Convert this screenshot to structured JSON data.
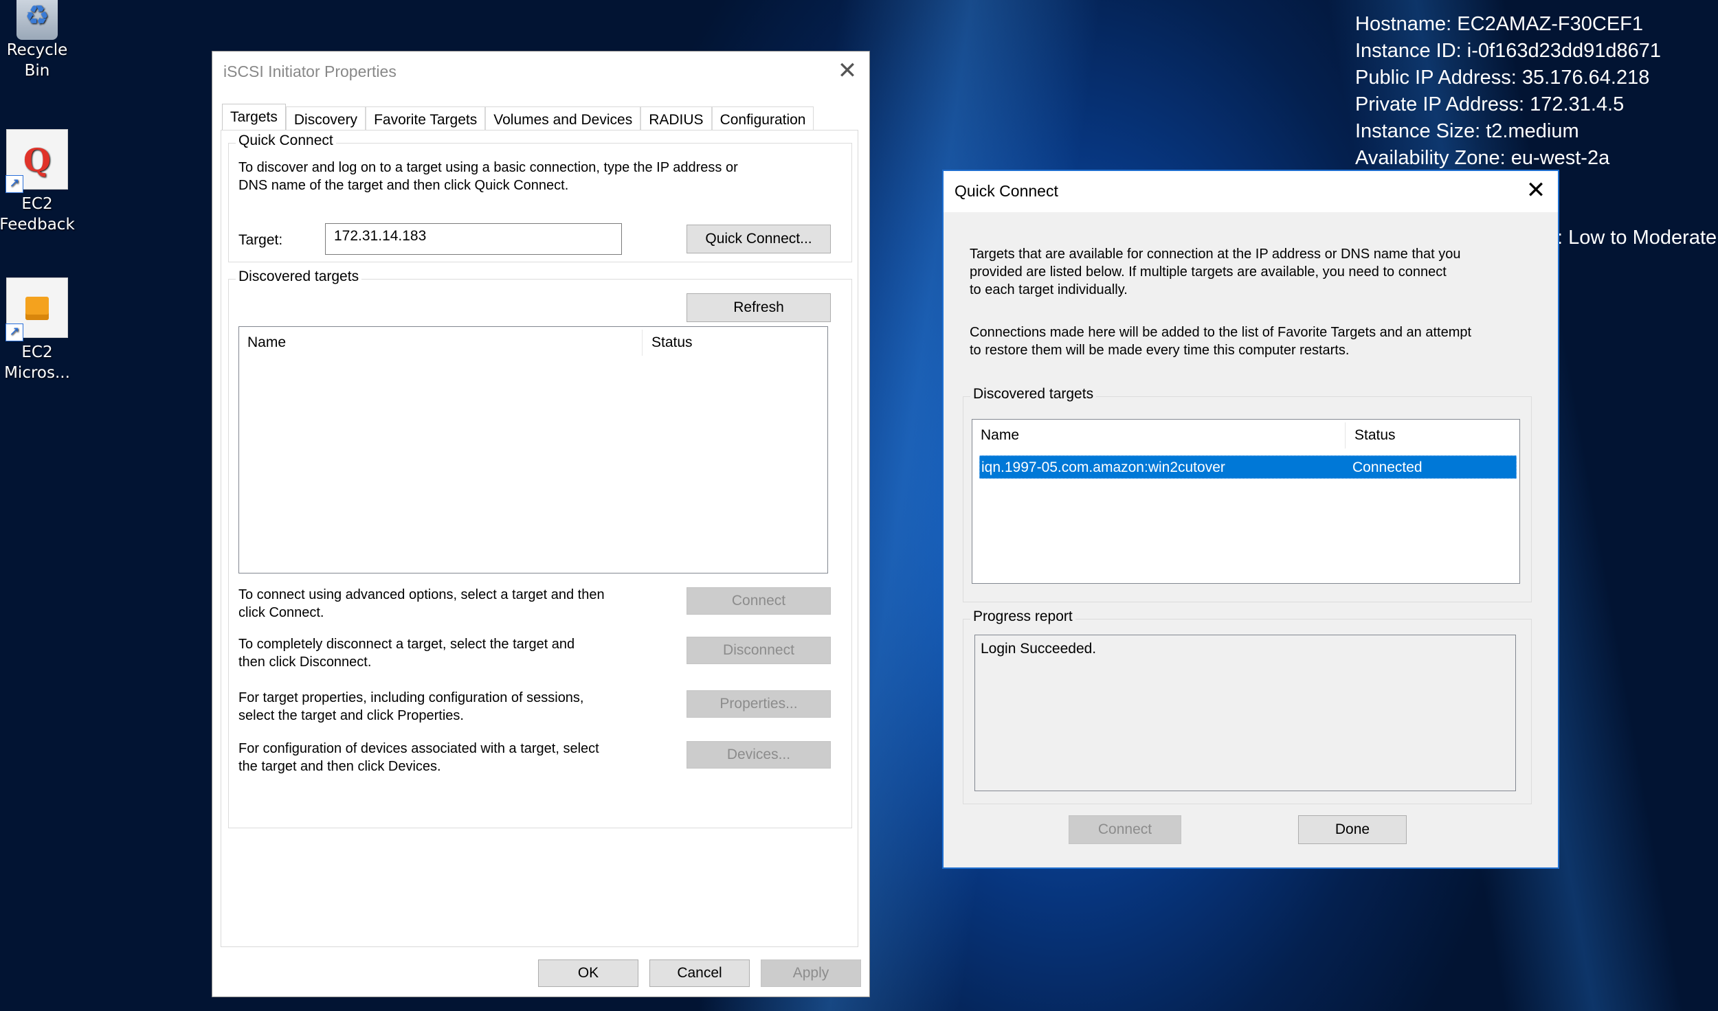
{
  "desktop": {
    "icons": [
      {
        "label": "Recycle Bin"
      },
      {
        "label": "EC2 Feedback",
        "line1": "EC2",
        "line2": "Feedback"
      },
      {
        "label": "EC2 Micros...",
        "line1": "EC2",
        "line2": "Micros..."
      }
    ],
    "info": [
      "Hostname: EC2AMAZ-F30CEF1",
      "Instance ID: i-0f163d23dd91d8671",
      "Public IP Address: 35.176.64.218",
      "Private IP Address: 172.31.4.5",
      "Instance Size: t2.medium",
      "Availability Zone: eu-west-2a"
    ],
    "partial_line": ": Low to Moderate"
  },
  "main_window": {
    "title": "iSCSI Initiator Properties",
    "tabs": [
      "Targets",
      "Discovery",
      "Favorite Targets",
      "Volumes and Devices",
      "RADIUS",
      "Configuration"
    ],
    "quick_connect": {
      "group_label": "Quick Connect",
      "description_1": "To discover and log on to a target using a basic connection, type the IP address or",
      "description_2": "DNS name of the target and then click Quick Connect.",
      "target_label": "Target:",
      "target_value": "172.31.14.183",
      "button": "Quick Connect..."
    },
    "discovered": {
      "group_label": "Discovered targets",
      "refresh_button": "Refresh",
      "columns": [
        "Name",
        "Status"
      ],
      "actions": [
        {
          "text_1": "To connect using advanced options, select a target and then",
          "text_2": "click Connect.",
          "button": "Connect"
        },
        {
          "text_1": "To completely disconnect a target, select the target and",
          "text_2": "then click Disconnect.",
          "button": "Disconnect"
        },
        {
          "text_1": "For target properties, including configuration of sessions,",
          "text_2": "select the target and click Properties.",
          "button": "Properties..."
        },
        {
          "text_1": "For configuration of devices associated with a target, select",
          "text_2": "the target and then click Devices.",
          "button": "Devices..."
        }
      ]
    },
    "footer": {
      "ok": "OK",
      "cancel": "Cancel",
      "apply": "Apply"
    }
  },
  "quick_connect_dialog": {
    "title": "Quick Connect",
    "intro_1": "Targets that are available for connection at the IP address or DNS name that you",
    "intro_2": "provided are listed below.  If multiple targets are available, you need to connect",
    "intro_3": "to each target individually.",
    "note_1": "Connections made here will be added to the list of Favorite Targets and an attempt",
    "note_2": "to restore them will be made every time this computer restarts.",
    "discovered": {
      "group_label": "Discovered targets",
      "columns": [
        "Name",
        "Status"
      ],
      "rows": [
        {
          "name": "iqn.1997-05.com.amazon:win2cutover",
          "status": "Connected"
        }
      ]
    },
    "progress": {
      "group_label": "Progress report",
      "text": "Login Succeeded."
    },
    "buttons": {
      "connect": "Connect",
      "done": "Done"
    }
  }
}
